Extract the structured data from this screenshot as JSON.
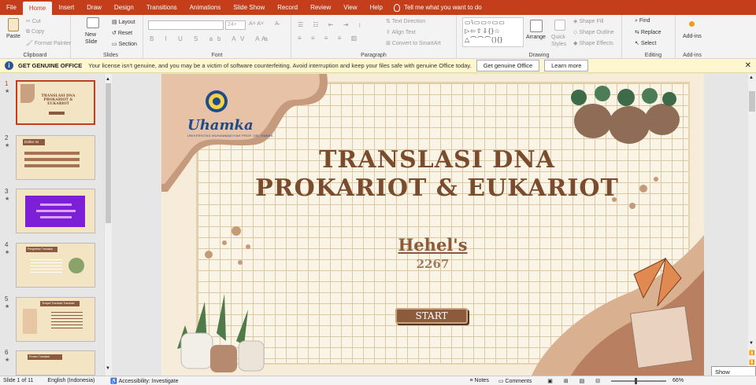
{
  "tabs": [
    "File",
    "Home",
    "Insert",
    "Draw",
    "Design",
    "Transitions",
    "Animations",
    "Slide Show",
    "Record",
    "Review",
    "View",
    "Help"
  ],
  "active_tab": "Home",
  "tell_me": "Tell me what you want to do",
  "ribbon": {
    "clipboard": {
      "label": "Clipboard",
      "paste": "Paste",
      "cut": "Cut",
      "copy": "Copy",
      "format_painter": "Format Painter"
    },
    "slides": {
      "label": "Slides",
      "new_slide": "New Slide",
      "layout": "Layout",
      "reset": "Reset",
      "section": "Section"
    },
    "font": {
      "label": "Font",
      "size": "24+"
    },
    "paragraph": {
      "label": "Paragraph",
      "text_direction": "Text Direction",
      "align_text": "Align Text",
      "convert_smartart": "Convert to SmartArt"
    },
    "drawing": {
      "label": "Drawing",
      "arrange": "Arrange",
      "quick_styles": "Quick Styles",
      "shape_fill": "Shape Fill",
      "shape_outline": "Shape Outline",
      "shape_effects": "Shape Effects"
    },
    "editing": {
      "label": "Editing",
      "find": "Find",
      "replace": "Replace",
      "select": "Select"
    },
    "addins": {
      "label": "Add-ins",
      "addins": "Add-ins"
    }
  },
  "infobar": {
    "title": "GET GENUINE OFFICE",
    "message": "Your license isn't genuine, and you may be a victim of software counterfeiting. Avoid interruption and keep your files safe with genuine Office today.",
    "btn_genuine": "Get genuine Office",
    "btn_learn": "Learn more"
  },
  "thumbnails": [
    {
      "num": "1",
      "title": "TRANSLASI DNA PROKARIOT & EUKARIOT",
      "color": "#f3e4c4"
    },
    {
      "num": "2",
      "title": "Daftar Isi",
      "color": "#f3e4c4"
    },
    {
      "num": "3",
      "title": "",
      "color": "#f3e4c4"
    },
    {
      "num": "4",
      "title": "Pengertian Translasi",
      "color": "#f3e4c4"
    },
    {
      "num": "5",
      "title": "Tempat Translasi Translasi",
      "color": "#f3e4c4"
    },
    {
      "num": "6",
      "title": "Proses Translasi",
      "color": "#f3e4c4"
    }
  ],
  "slide": {
    "logo_name": "Uhamka",
    "logo_sub": "UNIVERSITAS MUHAMMADIYAH PROF. DR. HAMKA",
    "title_line1": "TRANSLASI DNA",
    "title_line2": "PROKARIOT & EUKARIOT",
    "subtitle": "Hehel's",
    "number": "2267",
    "start": "START"
  },
  "status": {
    "slide_of": "Slide 1 of 11",
    "language": "English (Indonesia)",
    "accessibility": "Accessibility: Investigate",
    "notes": "Notes",
    "comments": "Comments",
    "zoom": "66%",
    "show_desktop": "Show desktop"
  },
  "colors": {
    "accent": "#c43e1c",
    "slide_brown": "#7a4b2c",
    "info_bg": "#fdf6cf"
  }
}
